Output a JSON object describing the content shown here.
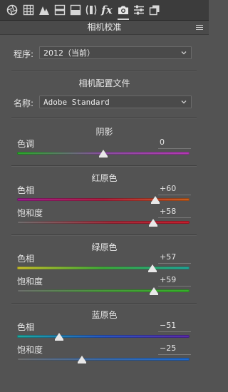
{
  "toolbar": {
    "icons": [
      "basic-aperture-icon",
      "tone-curve-grid-icon",
      "detail-triangle-icon",
      "hsl-icon",
      "split-toning-icon",
      "lens-corrections-icon",
      "effects-fx-icon",
      "camera-calibration-icon",
      "presets-sliders-icon",
      "snapshots-icon"
    ],
    "fx_label": "fx",
    "active": "camera-calibration-icon"
  },
  "panel": {
    "title": "相机校准",
    "process_label": "程序:",
    "process_value": "2012（当前）",
    "profile_heading": "相机配置文件",
    "name_label": "名称:",
    "name_value": "Adobe Standard"
  },
  "shadows": {
    "heading": "阴影",
    "tint_label": "色调",
    "tint_value": "0",
    "tint": 0
  },
  "red_primary": {
    "heading": "红原色",
    "hue_label": "色相",
    "hue_value": "+60",
    "hue": 60,
    "saturation_label": "饱和度",
    "saturation_value": "+58",
    "saturation": 58
  },
  "green_primary": {
    "heading": "绿原色",
    "hue_label": "色相",
    "hue_value": "+57",
    "hue": 57,
    "saturation_label": "饱和度",
    "saturation_value": "+59",
    "saturation": 59
  },
  "blue_primary": {
    "heading": "蓝原色",
    "hue_label": "色相",
    "hue_value": "−51",
    "hue": -51,
    "saturation_label": "饱和度",
    "saturation_value": "−25",
    "saturation": -25
  },
  "colors": {
    "panel_bg": "#535353",
    "toolbar_bg": "#3c3c3c",
    "text": "#e6e6e6"
  }
}
